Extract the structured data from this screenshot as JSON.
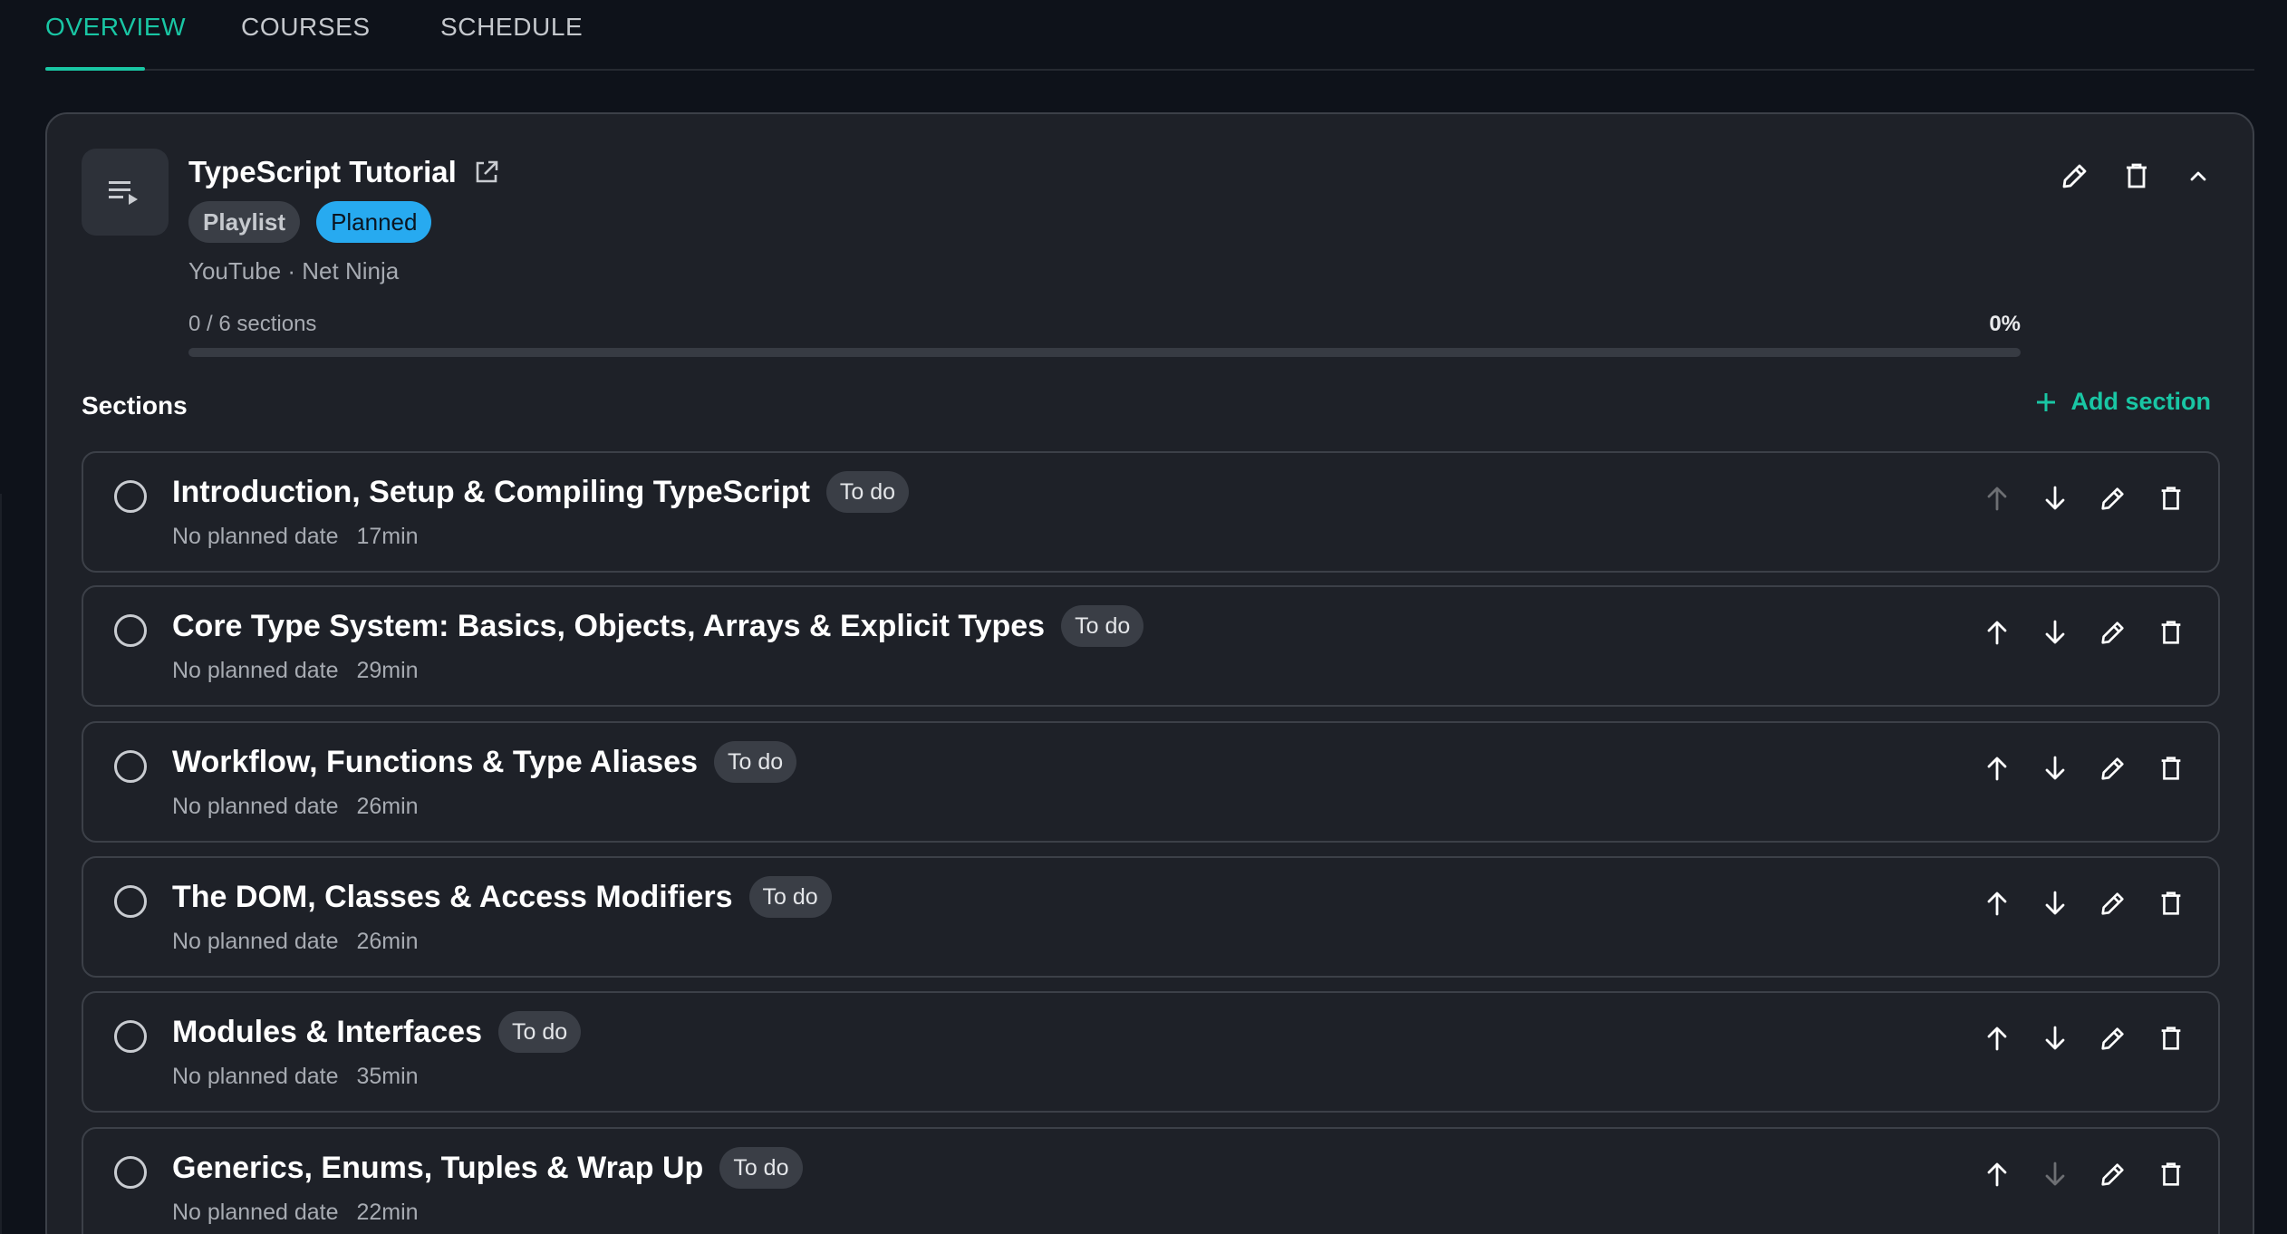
{
  "tabs": [
    {
      "label": "OVERVIEW",
      "active": true
    },
    {
      "label": "COURSES",
      "active": false
    },
    {
      "label": "SCHEDULE",
      "active": false
    }
  ],
  "course": {
    "title": "TypeScript Tutorial",
    "type_chip": "Playlist",
    "status_chip": "Planned",
    "source": "YouTube · Net Ninja",
    "progress_label": "0 / 6 sections",
    "progress_percent_label": "0%",
    "progress_value": 0
  },
  "sections_header": {
    "title": "Sections",
    "add_label": "Add section"
  },
  "sections": [
    {
      "title": "Introduction, Setup & Compiling TypeScript",
      "status": "To do",
      "date": "No planned date",
      "duration": "17min"
    },
    {
      "title": "Core Type System: Basics, Objects, Arrays & Explicit Types",
      "status": "To do",
      "date": "No planned date",
      "duration": "29min"
    },
    {
      "title": "Workflow, Functions & Type Aliases",
      "status": "To do",
      "date": "No planned date",
      "duration": "26min"
    },
    {
      "title": "The DOM, Classes & Access Modifiers",
      "status": "To do",
      "date": "No planned date",
      "duration": "26min"
    },
    {
      "title": "Modules & Interfaces",
      "status": "To do",
      "date": "No planned date",
      "duration": "35min"
    },
    {
      "title": "Generics, Enums, Tuples & Wrap Up",
      "status": "To do",
      "date": "No planned date",
      "duration": "22min"
    }
  ],
  "colors": {
    "accent": "#19c6a4",
    "planned": "#27aaf0",
    "background": "#0e121a",
    "card": "#1e2128"
  },
  "icons": {
    "thumb": "playlist-play-icon",
    "external": "open-in-new-icon",
    "edit": "pencil-icon",
    "delete": "trash-icon",
    "collapse": "chevron-up-icon",
    "add": "plus-icon",
    "move_up": "arrow-up-icon",
    "move_down": "arrow-down-icon"
  }
}
